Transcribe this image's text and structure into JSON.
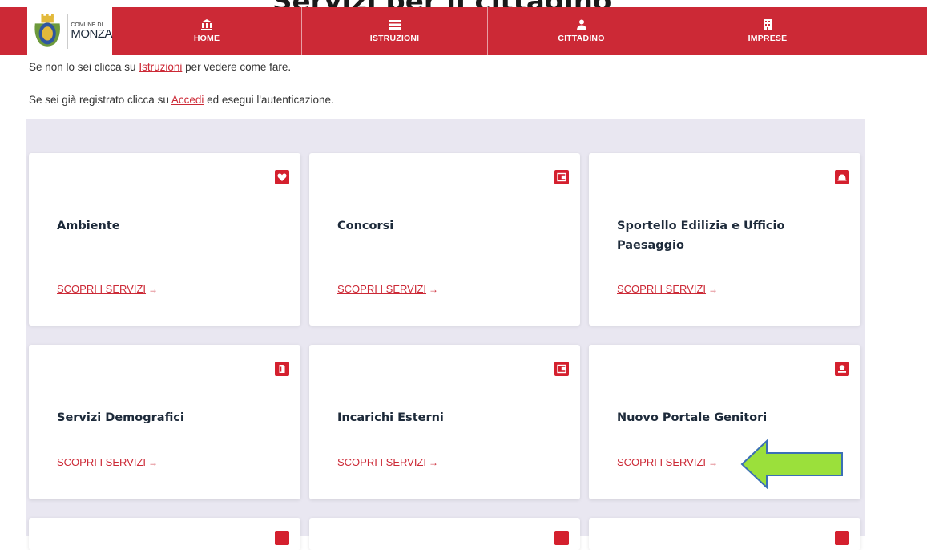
{
  "page": {
    "heading": "Servizi per il cittadino"
  },
  "logo": {
    "line1": "COMUNE DI",
    "line2": "MONZA"
  },
  "nav": {
    "items": [
      {
        "label": "HOME",
        "icon": "bank-icon"
      },
      {
        "label": "ISTRUZIONI",
        "icon": "grid-icon"
      },
      {
        "label": "CITTADINO",
        "icon": "person-icon"
      },
      {
        "label": "IMPRESE",
        "icon": "building-icon"
      }
    ]
  },
  "intro": {
    "line1_before": "Se non lo sei clicca su ",
    "line1_link": "Istruzioni",
    "line1_after": " per vedere come fare.",
    "line2_before": "Se sei già registrato clicca su ",
    "line2_link": "Accedi",
    "line2_after": " ed esegui l'autenticazione."
  },
  "cards": [
    {
      "title": "Ambiente",
      "link": "SCOPRI I SERVIZI",
      "icon": "heart-leaf-icon"
    },
    {
      "title": "Concorsi",
      "link": "SCOPRI I SERVIZI",
      "icon": "wallet-icon"
    },
    {
      "title": "Sportello Edilizia e Ufficio Paesaggio",
      "link": "SCOPRI I SERVIZI",
      "icon": "helmet-icon"
    },
    {
      "title": "Servizi Demografici",
      "link": "SCOPRI I SERVIZI",
      "icon": "document-icon"
    },
    {
      "title": "Incarichi Esterni",
      "link": "SCOPRI I SERVIZI",
      "icon": "wallet-icon"
    },
    {
      "title": "Nuovo Portale Genitori",
      "link": "SCOPRI I SERVIZI",
      "icon": "laptop-person-icon"
    }
  ],
  "link_arrow": "→",
  "colors": {
    "brand_red": "#cc2936",
    "panel_bg": "#e9e7f1",
    "annotation_green": "#9be03b"
  }
}
